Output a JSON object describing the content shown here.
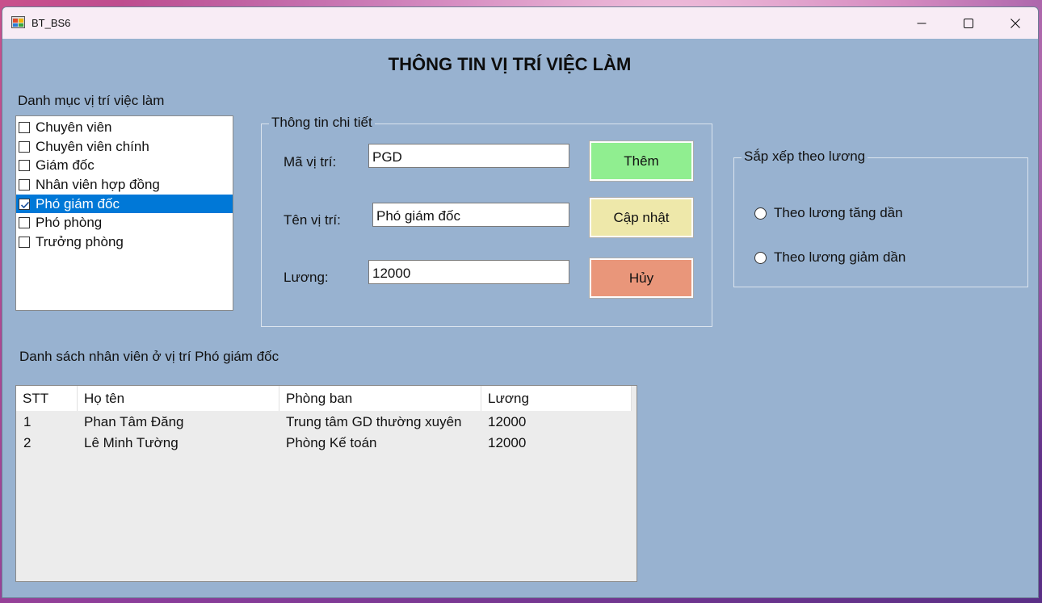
{
  "window": {
    "title": "BT_BS6"
  },
  "heading": "THÔNG TIN VỊ TRÍ VIỆC LÀM",
  "positions": {
    "label": "Danh mục vị trí việc làm",
    "items": [
      {
        "label": "Chuyên viên",
        "checked": false,
        "selected": false
      },
      {
        "label": "Chuyên viên chính",
        "checked": false,
        "selected": false
      },
      {
        "label": "Giám đốc",
        "checked": false,
        "selected": false
      },
      {
        "label": "Nhân viên hợp đồng",
        "checked": false,
        "selected": false
      },
      {
        "label": "Phó giám đốc",
        "checked": true,
        "selected": true
      },
      {
        "label": "Phó phòng",
        "checked": false,
        "selected": false
      },
      {
        "label": "Trưởng phòng",
        "checked": false,
        "selected": false
      }
    ]
  },
  "details": {
    "legend": "Thông tin chi tiết",
    "code_label": "Mã vị trí:",
    "code_value": "PGD",
    "name_label": "Tên vị trí:",
    "name_value": "Phó giám đốc",
    "salary_label": "Lương:",
    "salary_value": "12000"
  },
  "buttons": {
    "add": "Thêm",
    "update": "Cập nhật",
    "cancel": "Hủy"
  },
  "colors": {
    "form_bg": "#98b2d0",
    "add": "#90ee90",
    "update": "#eee8aa",
    "cancel": "#e9967a",
    "selection": "#0078d7"
  },
  "sort": {
    "legend": "Sắp xếp theo lương",
    "ascending": "Theo lương tăng dần",
    "descending": "Theo lương giảm dần"
  },
  "employees": {
    "label": "Danh sách nhân viên ở vị trí Phó giám đốc",
    "columns": [
      "STT",
      "Họ tên",
      "Phòng ban",
      "Lương"
    ],
    "rows": [
      [
        "1",
        "Phan Tâm Đăng",
        "Trung tâm GD thường xuyên",
        "12000"
      ],
      [
        "2",
        "Lê Minh Tường",
        "Phòng Kế toán",
        "12000"
      ]
    ]
  }
}
